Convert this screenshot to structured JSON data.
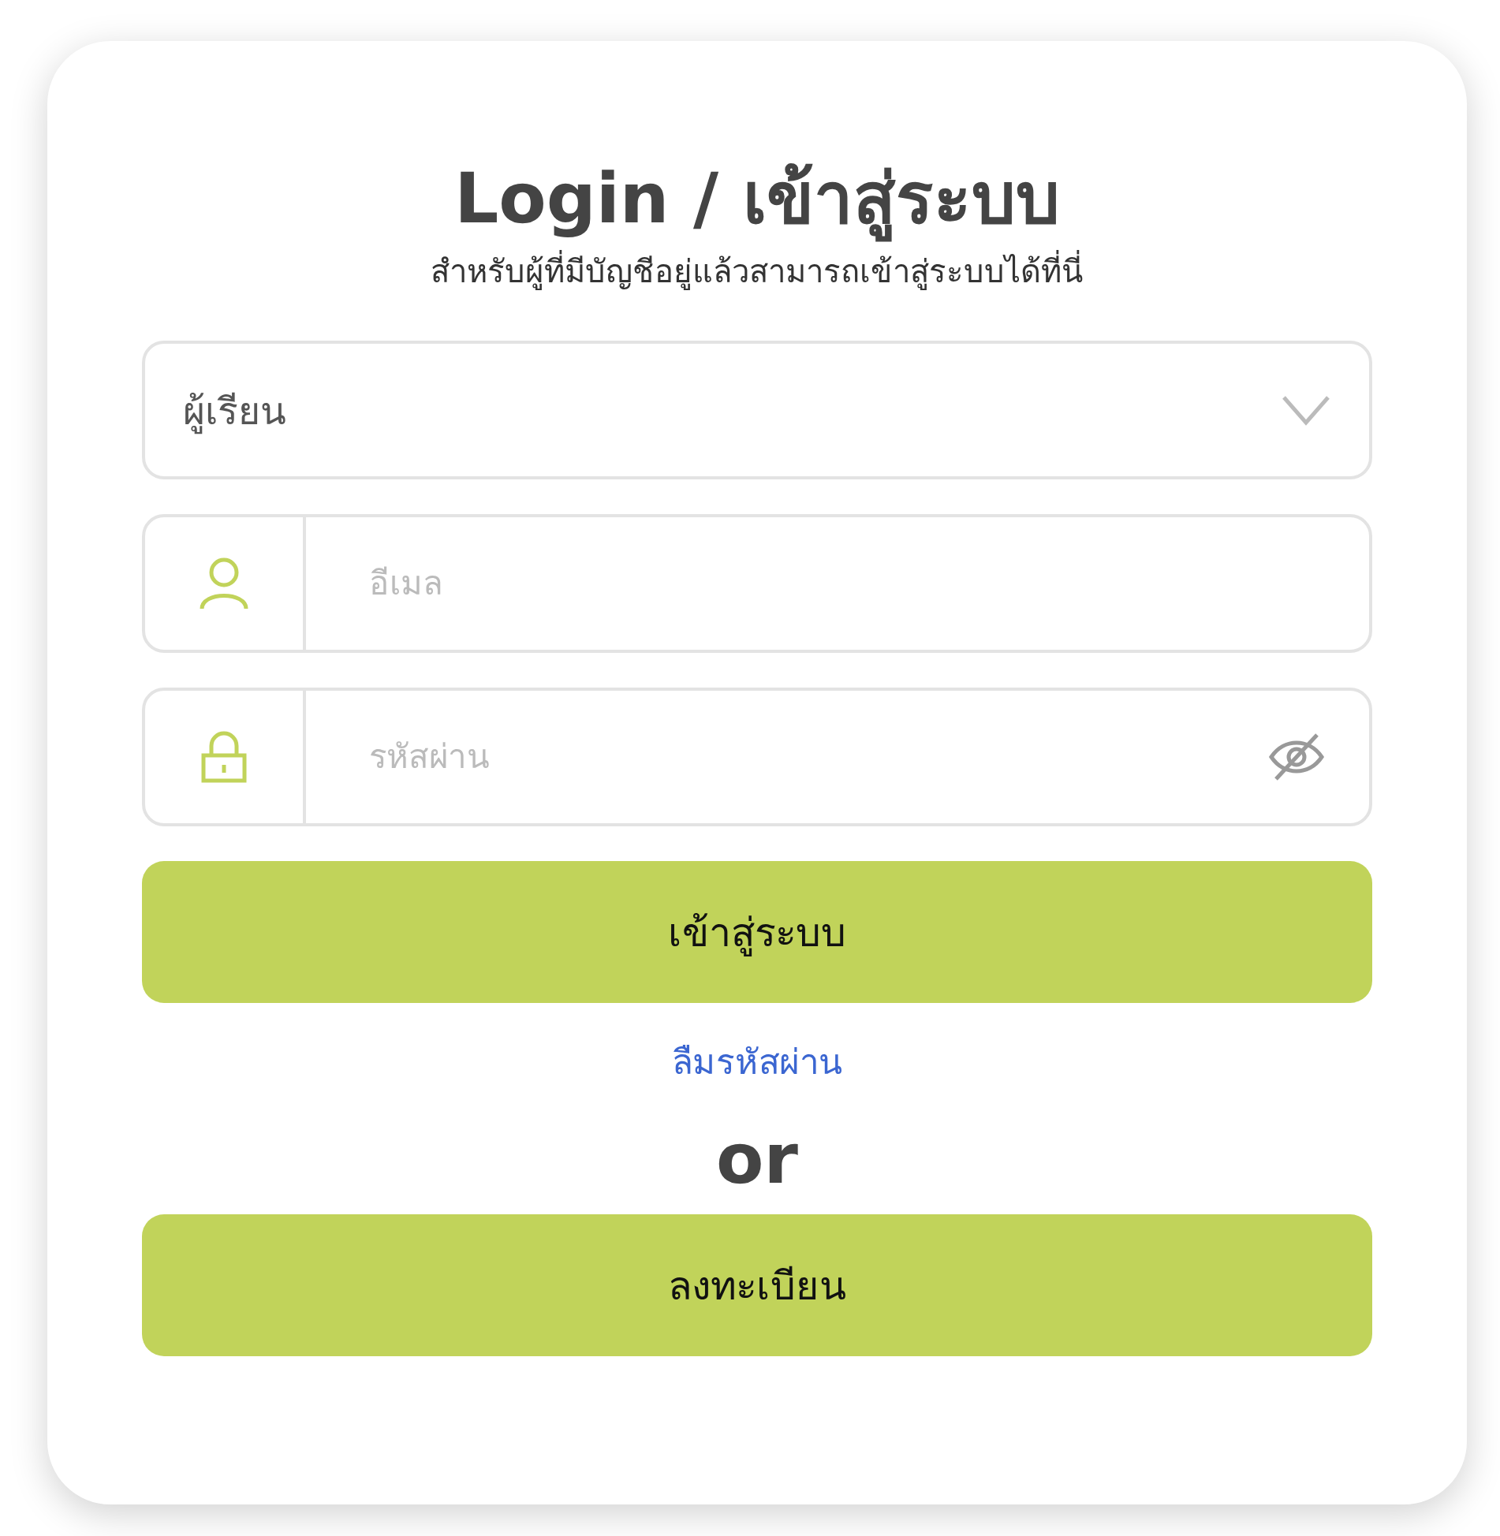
{
  "title": "Login / เข้าสู่ระบบ",
  "subtitle": "สำหรับผู้ที่มีบัญชีอยู่แล้วสามารถเข้าสู่ระบบได้ที่นี่",
  "role_select": {
    "value": "ผู้เรียน"
  },
  "email_field": {
    "placeholder": "อีเมล"
  },
  "password_field": {
    "placeholder": "รหัสผ่าน"
  },
  "login_button": "เข้าสู่ระบบ",
  "forgot_link": "ลืมรหัสผ่าน",
  "divider_text": "or",
  "register_button": "ลงทะเบียน"
}
